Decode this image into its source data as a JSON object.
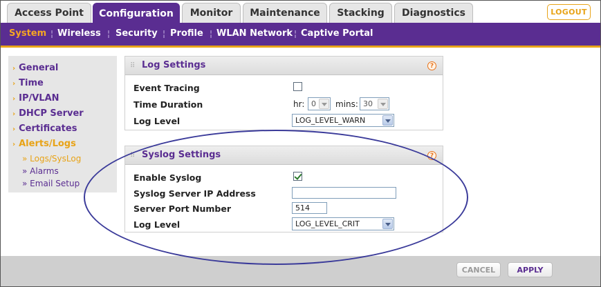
{
  "top_tabs": [
    {
      "label": "Access Point",
      "active": false
    },
    {
      "label": "Configuration",
      "active": true
    },
    {
      "label": "Monitor",
      "active": false
    },
    {
      "label": "Maintenance",
      "active": false
    },
    {
      "label": "Stacking",
      "active": false
    },
    {
      "label": "Diagnostics",
      "active": false
    }
  ],
  "logout_label": "LOGOUT",
  "sub_nav": [
    {
      "label": "System",
      "active": true
    },
    {
      "label": "Wireless",
      "active": false
    },
    {
      "label": "Security",
      "active": false
    },
    {
      "label": "Profile",
      "active": false
    },
    {
      "label": "WLAN Network",
      "active": false
    },
    {
      "label": "Captive Portal",
      "active": false
    }
  ],
  "sub_nav_separator": "¦",
  "left_nav": {
    "arrow": "›",
    "sub_arrow": "»",
    "items": [
      {
        "label": "General"
      },
      {
        "label": "Time"
      },
      {
        "label": "IP/VLAN"
      },
      {
        "label": "DHCP Server"
      },
      {
        "label": "Certificates"
      },
      {
        "label": "Alerts/Logs",
        "expanded": true
      }
    ],
    "sub_items": [
      {
        "label": "Logs/SysLog",
        "active": true
      },
      {
        "label": "Alarms",
        "active": false
      },
      {
        "label": "Email Setup",
        "active": false
      }
    ]
  },
  "log_settings": {
    "title": "Log Settings",
    "help": "?",
    "event_tracing_label": "Event Tracing",
    "event_tracing_checked": false,
    "time_duration_label": "Time Duration",
    "hr_label": "hr:",
    "hr_value": "0",
    "mins_label": "mins:",
    "mins_value": "30",
    "log_level_label": "Log Level",
    "log_level_value": "LOG_LEVEL_WARN"
  },
  "syslog_settings": {
    "title": "Syslog Settings",
    "help": "?",
    "enable_label": "Enable Syslog",
    "enable_checked": true,
    "server_ip_label": "Syslog Server IP Address",
    "server_ip_value": "",
    "port_label": "Server Port Number",
    "port_value": "514",
    "log_level_label": "Log Level",
    "log_level_value": "LOG_LEVEL_CRIT"
  },
  "buttons": {
    "cancel": "CANCEL",
    "apply": "APPLY"
  },
  "colors": {
    "brand_purple": "#5a2d91",
    "accent_orange": "#e8a317",
    "annotation": "#3b3b9a"
  }
}
